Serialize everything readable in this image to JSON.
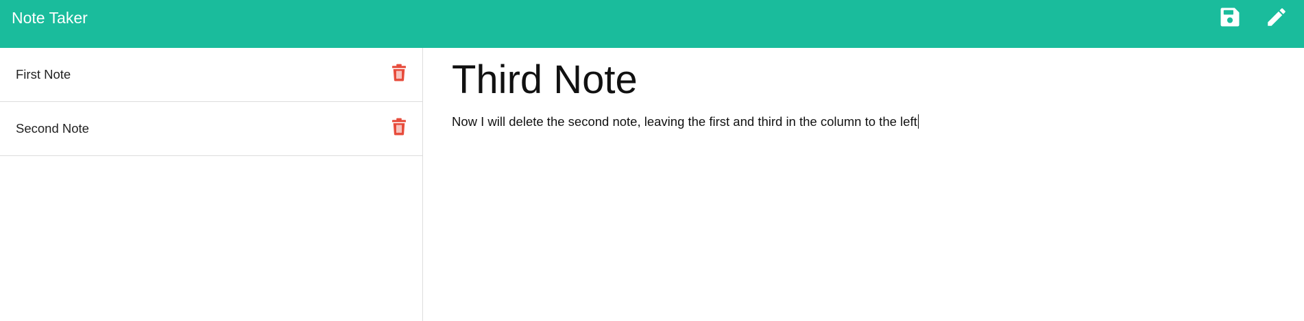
{
  "app": {
    "title": "Note Taker",
    "accent_color": "#1abc9c",
    "danger_color": "#e74c3c"
  },
  "navbar": {
    "icons": [
      "save-icon",
      "pencil-icon"
    ]
  },
  "sidebar": {
    "notes": [
      {
        "title": "First Note",
        "action_icon": "trash-icon"
      },
      {
        "title": "Second Note",
        "action_icon": "trash-icon"
      }
    ]
  },
  "editor": {
    "title": "Third Note",
    "text": "Now I will delete the second note, leaving the first and third in the column to the left"
  }
}
